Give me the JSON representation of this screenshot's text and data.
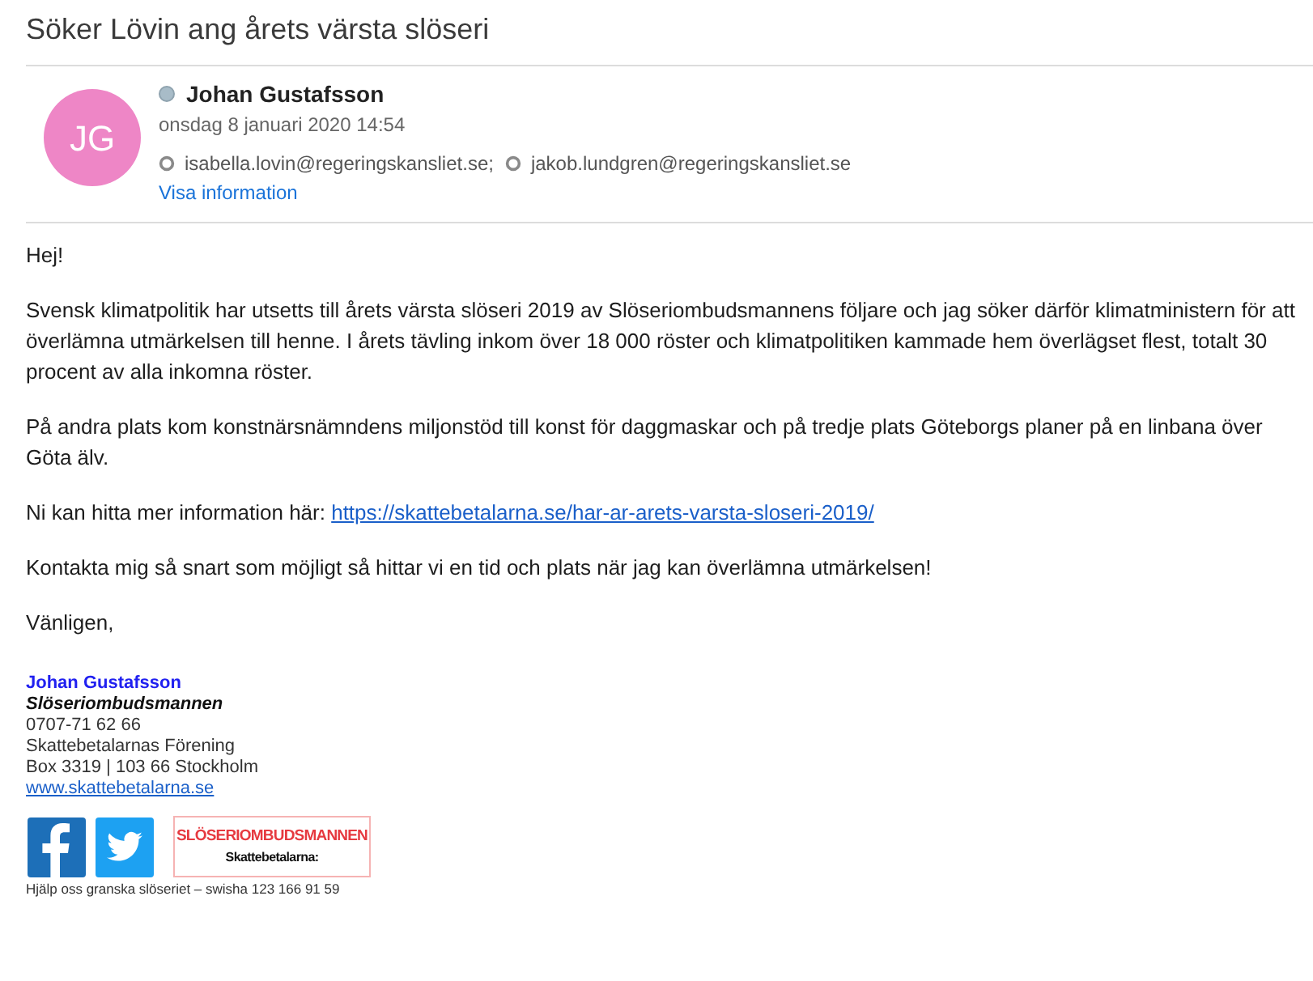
{
  "subject": "Söker Lövin ang årets värsta slöseri",
  "sender": {
    "initials": "JG",
    "name": "Johan Gustafsson",
    "date": "onsdag 8 januari 2020 14:54",
    "recipients": [
      "isabella.lovin@regeringskansliet.se;",
      "jakob.lundgren@regeringskansliet.se"
    ],
    "details_link": "Visa information"
  },
  "body": {
    "paragraphs": [
      {
        "text": "Hej!"
      },
      {
        "text": "Svensk klimatpolitik har utsetts till årets värsta slöseri 2019 av Slöseriombudsmannens följare och jag söker därför klimatministern för att överlämna utmärkelsen till henne. I årets tävling inkom över 18 000 röster och klimatpolitiken kammade hem överlägset flest, totalt 30 procent av alla inkomna röster."
      },
      {
        "text": "På andra plats kom konstnärsnämndens miljonstöd till konst för daggmaskar och på tredje plats Göteborgs planer på en linbana över Göta älv."
      },
      {
        "text": "Ni kan hitta mer information här:",
        "link": "https://skattebetalarna.se/har-ar-arets-varsta-sloseri-2019/"
      },
      {
        "text": "Kontakta mig så snart som möjligt så hittar vi en tid och plats när jag kan överlämna utmärkelsen!"
      },
      {
        "text": "Vänligen,"
      }
    ]
  },
  "signature": {
    "name": "Johan Gustafsson",
    "title": "Slöseriombudsmannen",
    "lines": [
      "0707-71 62 66",
      "Skattebetalarnas Förening",
      "Box 3319 | 103 66 Stockholm"
    ],
    "website": "www.skattebetalarna.se",
    "logo": {
      "title": "SLÖSERIOMBUDSMANNEN",
      "subtitle": "Skattebetalarna:"
    },
    "footer": "Hjälp oss granska slöseriet – swisha 123 166 91 59"
  }
}
